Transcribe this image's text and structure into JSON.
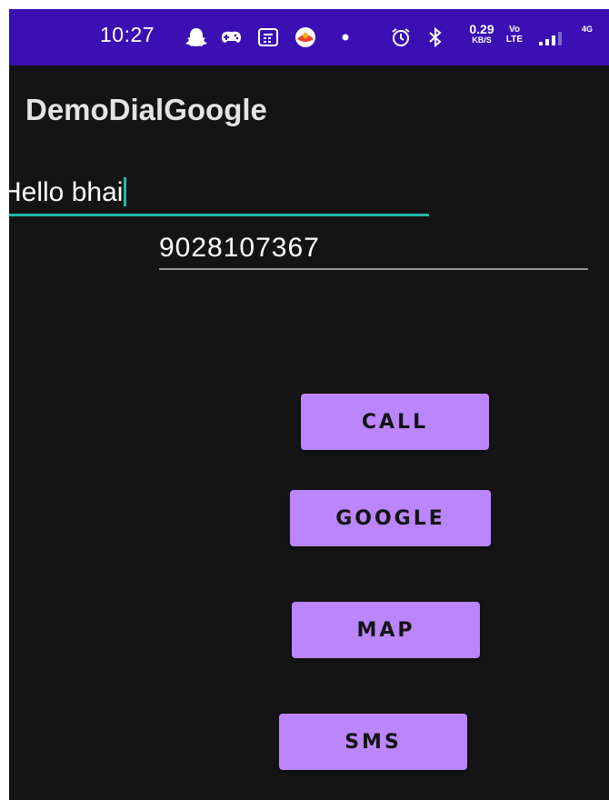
{
  "status_bar": {
    "time": "10:27",
    "net_speed_value": "0.29",
    "net_speed_unit": "KB/S",
    "volte_top": "Vo",
    "volte_bottom": "LTE",
    "network": "4G",
    "icons": [
      "snapchat-icon",
      "gamepad-icon",
      "message-icon",
      "app-icon",
      "dot-icon",
      "alarm-icon",
      "bluetooth-icon",
      "signal-icon"
    ]
  },
  "app": {
    "title": "DemoDialGoogle"
  },
  "fields": {
    "name_value": "Hello bhai",
    "phone_value": "9028107367"
  },
  "buttons": {
    "call": "CALL",
    "google": "GOOGLE",
    "map": "MAP",
    "sms": "SMS"
  },
  "colors": {
    "status_bar": "#3a0fb3",
    "background": "#141414",
    "button": "#bb86fc",
    "accent": "#1fb8a7"
  }
}
